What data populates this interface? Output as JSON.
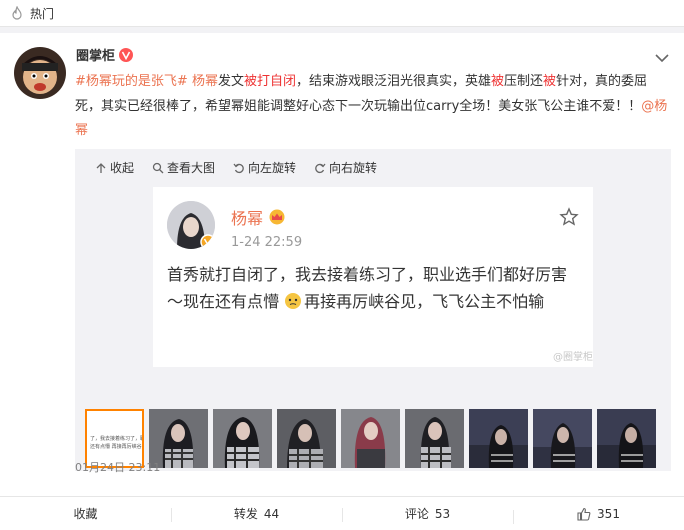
{
  "header": {
    "hot_label": "热门"
  },
  "post": {
    "username": "圈掌柜",
    "text": {
      "topic1": "#杨幂玩的是张飞#",
      "topic2": "杨幂",
      "seg1": "发文",
      "hl1": "被打自闭",
      "seg2": "，结束游戏眼泛泪光很真实，英雄",
      "hl2": "被",
      "seg3": "压制还",
      "hl3": "被",
      "seg4": "针对，真的委屈死，其实已经很棒了，希望幂姐能调整好心态下一次玩输出位carry全场！美女张飞公主谁不爱！！",
      "mention": "@杨幂"
    },
    "timestamp": "01月24日 23:11"
  },
  "media": {
    "toolbar": {
      "collapse": "收起",
      "view_large": "查看大图",
      "rotate_left": "向左旋转",
      "rotate_right": "向右旋转"
    },
    "inner_post": {
      "name": "杨幂",
      "time": "1-24 22:59",
      "text_a": "首秀就打自闭了，我去接着练习了，职业选手们都好厉害～现在还有点懵",
      "text_b": "再接再厉峡谷见，飞飞公主不怕输",
      "watermark": "@圈掌柜"
    },
    "thumb_text": {
      "line1": "了，我去接着练习了，职",
      "line2": "还有点懵  再接再厉峡谷"
    },
    "thumbnails_count": 9,
    "active_thumbnail": 1
  },
  "footer": {
    "collect": "收藏",
    "repost_label": "转发",
    "repost_count": "44",
    "comment_label": "评论",
    "comment_count": "53",
    "like_count": "351"
  }
}
